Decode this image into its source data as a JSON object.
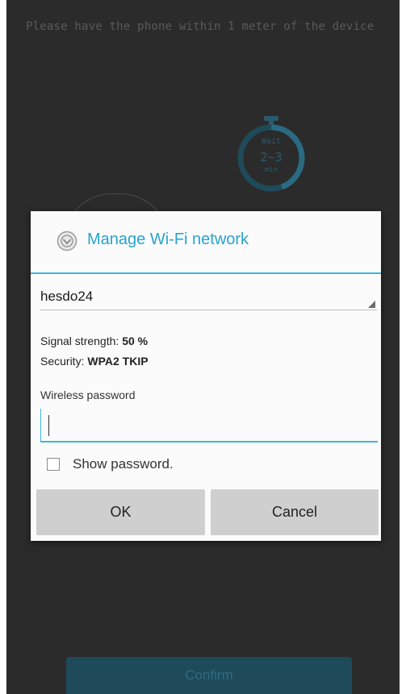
{
  "background": {
    "hint_text": "Please have the phone within 1 meter of the device",
    "timer": {
      "line1": "Wait",
      "line2": "2~3",
      "line3": "min"
    },
    "confirm_label": "Confirm"
  },
  "dialog": {
    "title": "Manage Wi-Fi network",
    "icon": "wifi-settings-icon",
    "ssid_value": "hesdo24",
    "signal_label": "Signal strength:",
    "signal_value": "50 %",
    "security_label": "Security:",
    "security_value": "WPA2 TKIP",
    "password_label": "Wireless password",
    "password_value": "",
    "show_password_label": "Show password.",
    "show_password_checked": false,
    "ok_label": "OK",
    "cancel_label": "Cancel"
  },
  "colors": {
    "accent": "#29a3cf",
    "screen_bg": "#2b2b2b",
    "button_bg": "#cfcfcf"
  }
}
